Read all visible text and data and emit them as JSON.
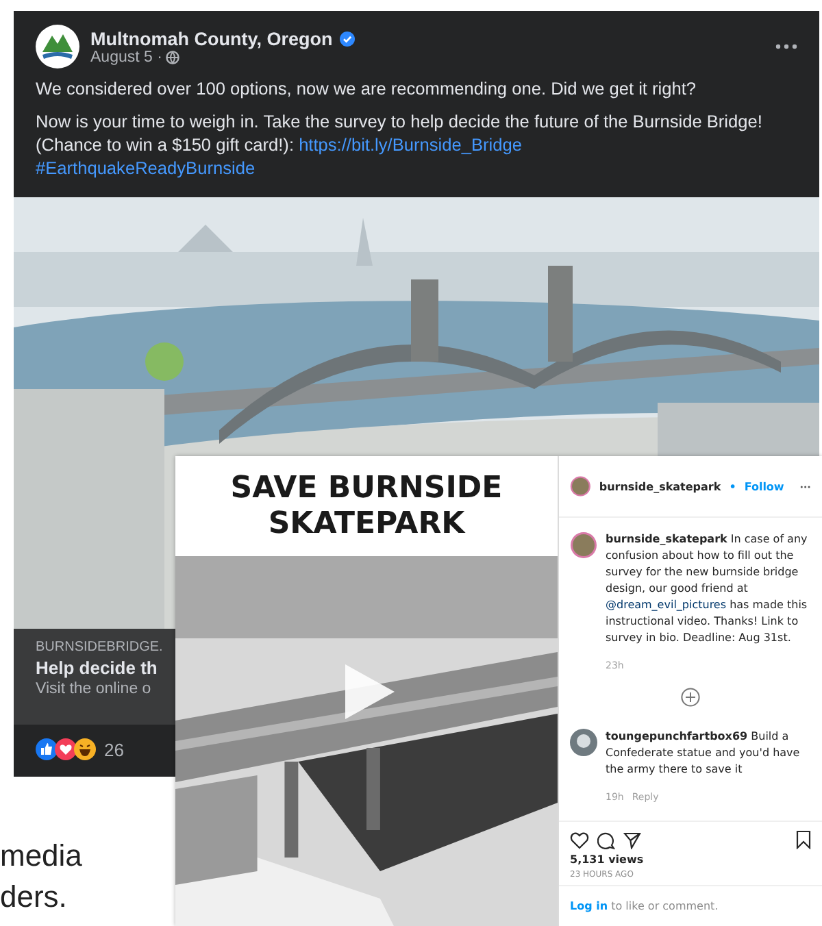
{
  "facebook_post": {
    "page_name": "Multnomah County, Oregon",
    "date": "August 5 ·",
    "paragraphs": [
      {
        "text": "We considered over 100 options, now we are recommending one. Did we get it right?"
      },
      {
        "text": "Now is your time to weigh in. Take the survey to help decide the future of the Burnside Bridge! (Chance to win a $150 gift card!):",
        "link": "https://bit.ly/Burnside_Bridge",
        "hashtag": "#EarthquakeReadyBurnside"
      }
    ],
    "link_preview": {
      "domain": "BURNSIDEBRIDGE.",
      "title": "Help decide th",
      "subtitle": "Visit the online o"
    },
    "reactions": {
      "count": "26"
    }
  },
  "instagram_post": {
    "banner": "SAVE BURNSIDE SKATEPARK",
    "account": "burnside_skatepark",
    "separator": "•",
    "follow": "Follow",
    "caption": {
      "user": "burnside_skatepark",
      "text": "In case of any confusion about how to fill out the survey for the new burnside bridge design, our good friend at",
      "mention": "@dream_evil_pictures",
      "text_after": "has made this instructional video. Thanks! Link to survey in bio. Deadline: Aug 31st.",
      "time": "23h"
    },
    "comments": [
      {
        "user": "toungepunchfartbox69",
        "text": "Build a Confederate statue and you'd have the army there to save it",
        "time": "19h",
        "reply": "Reply"
      }
    ],
    "views": "5,131 views",
    "posted": "23 HOURS AGO",
    "login": {
      "link": "Log in",
      "text": "to like or comment."
    }
  },
  "slide_text": [
    "media",
    "ders."
  ]
}
